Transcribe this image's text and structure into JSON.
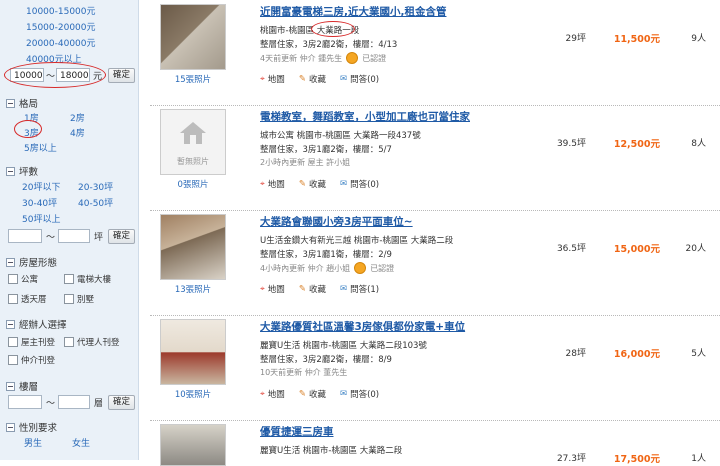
{
  "sidebar": {
    "price_ranges": [
      "10000-15000元",
      "15000-20000元",
      "20000-40000元",
      "40000元以上"
    ],
    "price_min": "10000",
    "price_sep": "～",
    "price_max": "18000",
    "price_unit": "元",
    "confirm_label": "確定",
    "layout_title": "格局",
    "layout_options": [
      "1房",
      "2房",
      "3房",
      "4房",
      "5房以上"
    ],
    "area_title": "坪數",
    "area_options": [
      "20坪以下",
      "20-30坪",
      "30-40坪",
      "40-50坪",
      "50坪以上"
    ],
    "area_sep": "～",
    "area_unit": "坪",
    "type_title": "房屋形態",
    "type_options": [
      "公寓",
      "電梯大樓",
      "透天厝",
      "別墅"
    ],
    "agent_title": "經辦人選擇",
    "agent_options": [
      "屋主刊登",
      "代理人刊登",
      "仲介刊登"
    ],
    "floor_title": "樓層",
    "floor_sep": "～",
    "floor_unit": "層",
    "gender_title": "性別要求",
    "gender_options": [
      "男生",
      "女生"
    ]
  },
  "listings": [
    {
      "title": "近開富豪電梯三房,近大業國小,租金含管",
      "address": "桃園市-桃園區 大業路一段",
      "layout": "整層住家，3房2廳2衛，樓層：4/13",
      "meta": "4天前更新  仲介 鍾先生",
      "badge": "已認證",
      "photo_count": "15張照片",
      "area": "29坪",
      "price": "11,500元",
      "views": "9人"
    },
    {
      "title": "電梯教室，舞蹈教室，小型加工廠也可當住家",
      "address": "城市公寓  桃園市-桃園區 大業路一段437號",
      "layout": "整層住家，3房1廳2衛，樓層：5/7",
      "meta": "2小時內更新  屋主 許小姐",
      "badge": "",
      "photo_count": "0張照片",
      "no_photo": "暫無照片",
      "area": "39.5坪",
      "price": "12,500元",
      "views": "8人"
    },
    {
      "title": "大業路會聯國小旁3房平面車位~",
      "address": "U生活金鑽大有新光三越  桃園市-桃園區 大業路二段",
      "layout": "整層住家，3房1廳1衛，樓層：2/9",
      "meta": "4小時內更新  仲介 趙小姐",
      "badge": "已認證",
      "photo_count": "13張照片",
      "area": "36.5坪",
      "price": "15,000元",
      "views": "20人"
    },
    {
      "title": "大業路優質社區溫馨3房傢俱都份家電+車位",
      "address": "麗寶U生活  桃園市-桃園區 大業路二段103號",
      "layout": "整層住家，3房2廳2衛，樓層：8/9",
      "meta": "10天前更新  仲介 董先生",
      "badge": "",
      "photo_count": "10張照片",
      "area": "28坪",
      "price": "16,000元",
      "views": "5人"
    },
    {
      "title": "優質捷運三房車",
      "address": "麗寶U生活  桃園市-桃園區 大業路二段",
      "layout": "",
      "meta": "",
      "badge": "",
      "photo_count": "",
      "area": "27.3坪",
      "price": "17,500元",
      "views": "1人"
    }
  ],
  "actions": {
    "map": "地圖",
    "save": "收藏",
    "qa": "問答(0)",
    "qa1": "問答(1)"
  },
  "icons": [
    "map-pin-icon",
    "save-icon",
    "qa-icon",
    "certified-badge-icon",
    "house-placeholder-icon",
    "minus-toggle-icon"
  ],
  "colors": {
    "link": "#2a6ab8",
    "price": "#f06514",
    "sidebar_bg": "#eaf1f8",
    "annotation": "#d72b2b"
  }
}
